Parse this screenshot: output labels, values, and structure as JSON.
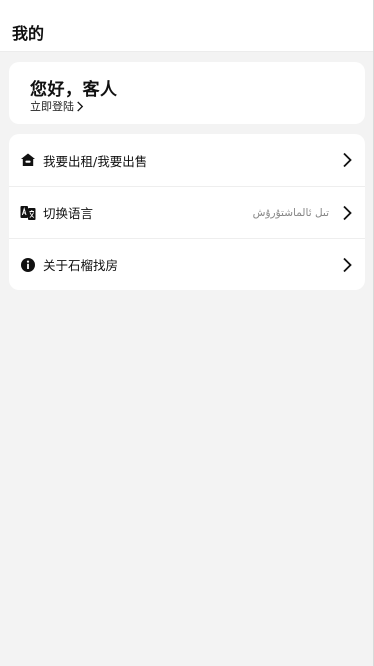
{
  "header": {
    "title": "我的"
  },
  "profile": {
    "greeting": "您好，客人",
    "login_label": "立即登陆"
  },
  "menu": {
    "items": [
      {
        "label": "我要出租/我要出售",
        "value": "",
        "icon": "house-icon"
      },
      {
        "label": "切换语言",
        "value": "تىل ئالماشتۇرۇش",
        "icon": "translate-icon"
      },
      {
        "label": "关于石榴找房",
        "value": "",
        "icon": "info-icon"
      }
    ]
  },
  "colors": {
    "background": "#f3f3f3",
    "card": "#ffffff",
    "text": "#111111",
    "secondary_text": "#888888"
  }
}
